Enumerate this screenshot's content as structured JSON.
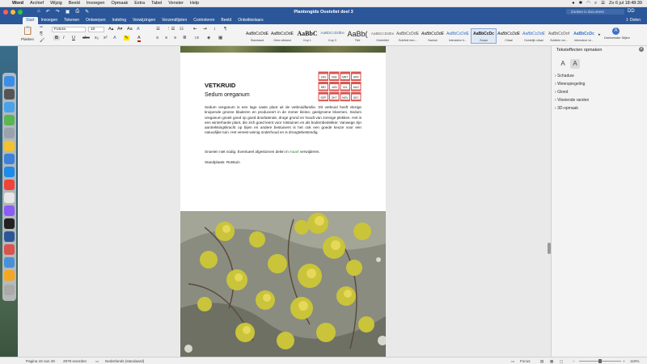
{
  "menubar": {
    "app": "Word",
    "items": [
      "Archief",
      "Wijzig",
      "Beeld",
      "Invoegen",
      "Opmaak",
      "Extra",
      "Tabel",
      "Venster",
      "Help"
    ],
    "clock": "Zo 6 jul  18:48:39"
  },
  "window": {
    "title": "Plantengids Oostvliet deel 3",
    "search_placeholder": "Zoeken in document",
    "user_initials": "DD"
  },
  "tabs": [
    "Start",
    "Invoegen",
    "Tekenen",
    "Ontwerpen",
    "Indeling",
    "Verwijzingen",
    "Verzendlijsten",
    "Controleren",
    "Beeld",
    "Ontwikkelaars"
  ],
  "share_label": "Delen",
  "ribbon": {
    "paste_label": "Plakken",
    "font_name": "Futura",
    "font_size": "10",
    "styles": [
      {
        "sample": "AaBbCcDdE",
        "name": "Standaard"
      },
      {
        "sample": "AaBbCcDdE",
        "name": "Geen afstand"
      },
      {
        "sample": "AaBbC",
        "name": "Kop 1"
      },
      {
        "sample": "AaBbCcDdEe",
        "name": "Kop 3"
      },
      {
        "sample": "AaBb(",
        "name": "Titel"
      },
      {
        "sample": "AaBbCcDdEe",
        "name": "Ondertitel"
      },
      {
        "sample": "AaBbCcDdE",
        "name": "Subtiele ben..."
      },
      {
        "sample": "AaBbCcDdE",
        "name": "Nadruk"
      },
      {
        "sample": "AaBbCcDdE",
        "name": "Intensieve b..."
      },
      {
        "sample": "AaBbCcDc",
        "name": "Zwaar"
      },
      {
        "sample": "AaBbCcDdE",
        "name": "Citaat"
      },
      {
        "sample": "AaBbCcDdE",
        "name": "Duidelijk citaat"
      },
      {
        "sample": "AaBbCcDof",
        "name": "Subtiele ver..."
      },
      {
        "sample": "AaBbCcDc",
        "name": "Intensieve ve..."
      }
    ],
    "styles_pane_label": "Deelvenster Stijlen"
  },
  "document": {
    "heading": "VETKRUID",
    "subheading": "Sedum oreganum",
    "paragraph1": "Sedum oreganum is een lage vaste plant uit de vetkruidfamilie. Dit vetkruid heeft vlezige kruipende groene bladeren en produceert in de zomer kleine, geelgroene bloemen. Sedum oreganum groeit goed op goed doorlatende, droge grond en houdt van zonnige plekken. Het is een winterharde plant, die zich goed leent voor rotstuinen en als bodembedekker. Vanwege zijn aantrekkingskracht op bijen en andere bestuivers is het ook een goede keuze voor een natuurlijke tuin. Het vereist weinig onderhoud en is droogtebestendig.",
    "paragraph2_before": "Snoeien niet nodig. Eventueel afgestorven delen in ",
    "paragraph2_green": "maart",
    "paragraph2_after": " verwijderen.",
    "paragraph3": "Standplaats: Rotstuin",
    "months": [
      "JAN",
      "FEB",
      "MRT",
      "APR",
      "MEI",
      "JUN",
      "JUL",
      "AUG",
      "SEP",
      "OKT",
      "NOV",
      "DEC"
    ],
    "calendar_colors": {
      "frame": "#d9534f",
      "cell": "#ffffff"
    }
  },
  "pane": {
    "title": "Teksteffecten opmaken",
    "items": [
      "Schaduw",
      "Weerspiegeling",
      "Gloed",
      "Vloeiende randen",
      "3D-opmaak"
    ]
  },
  "status": {
    "page": "Pagina 18 van 28",
    "words": "2978 woorden",
    "language": "Nederlands (standaard)",
    "focus": "Focus",
    "zoom": "110%"
  },
  "colors": {
    "accent": "#2b579a",
    "green_text": "#2e8b3a"
  }
}
